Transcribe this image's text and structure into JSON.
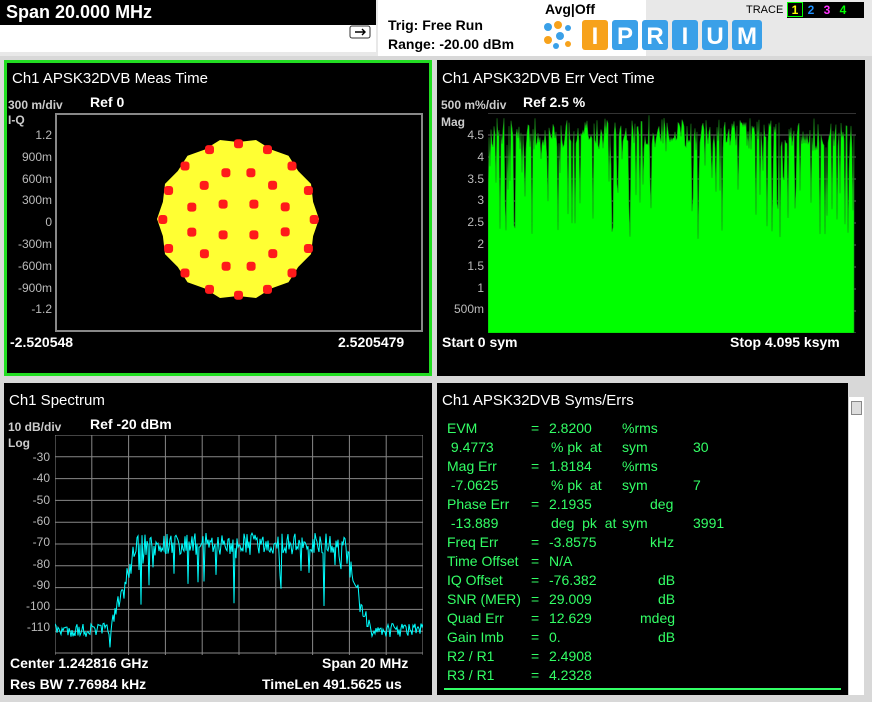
{
  "header": {
    "span_title": "Span 20.000 MHz",
    "trigger": "Trig: Free Run",
    "range": "Range: -20.00 dBm",
    "avg": "Avg|Off",
    "logo_text": "IPRIUM",
    "trace_label": "TRACE",
    "traces": [
      "1",
      "2",
      "3",
      "4"
    ]
  },
  "constellation": {
    "title": "Ch1 APSK32DVB Meas Time",
    "scale": "300 m/div",
    "ref": "Ref 0",
    "mode": "I-Q",
    "yticks": [
      "1.2",
      "900m",
      "600m",
      "300m",
      "0",
      "-300m",
      "-600m",
      "-900m",
      "-1.2"
    ],
    "x_start": "-2.520548",
    "x_stop": "2.5205479",
    "colors": {
      "cloud": "#ffff33",
      "points": "#ff1a1a"
    }
  },
  "errvect": {
    "title": "Ch1 APSK32DVB Err Vect Time",
    "scale": "500 m%/div",
    "ref": "Ref 2.5  %",
    "mode": "Mag",
    "yticks": [
      "4.5",
      "4",
      "3.5",
      "3",
      "2.5",
      "2",
      "1.5",
      "1",
      "500m"
    ],
    "start": "Start 0  sym",
    "stop": "Stop 4.095 ksym",
    "color": "#00ff00"
  },
  "spectrum": {
    "title": "Ch1 Spectrum",
    "scale": "10 dB/div",
    "ref": "Ref -20 dBm",
    "mode": "Log",
    "yticks": [
      "-30",
      "-40",
      "-50",
      "-60",
      "-70",
      "-80",
      "-90",
      "-100",
      "-110"
    ],
    "center": "Center 1.242816 GHz",
    "span": "Span 20 MHz",
    "rbw": "Res BW 7.76984 kHz",
    "timelen": "TimeLen 491.5625 us",
    "color": "#00ffff"
  },
  "symserr": {
    "title": "Ch1 APSK32DVB Syms/Errs",
    "rows": [
      {
        "label": "EVM",
        "eq": "=",
        "value": "2.8200",
        "unit": "%rms",
        "extra": ""
      },
      {
        "label": " 9.4773",
        "eq": "",
        "value": "% pk  at",
        "unit": "sym",
        "extra": "30"
      },
      {
        "label": "Mag Err",
        "eq": "=",
        "value": "1.8184",
        "unit": "%rms",
        "extra": ""
      },
      {
        "label": " -7.0625",
        "eq": "",
        "value": "% pk  at",
        "unit": "sym",
        "extra": "7"
      },
      {
        "label": "Phase Err",
        "eq": "=",
        "value": "2.1935",
        "unit": "deg",
        "extra": ""
      },
      {
        "label": " -13.889",
        "eq": "",
        "value": "deg  pk  at",
        "unit": "sym",
        "extra": "3991"
      },
      {
        "label": "Freq Err",
        "eq": "=",
        "value": "-3.8575",
        "unit": "kHz",
        "extra": ""
      },
      {
        "label": "Time Offset",
        "eq": "=",
        "value": "N/A",
        "unit": "",
        "extra": ""
      },
      {
        "label": "IQ Offset",
        "eq": "=",
        "value": "-76.382",
        "unit": "dB",
        "extra": ""
      },
      {
        "label": "SNR (MER)",
        "eq": "=",
        "value": "29.009",
        "unit": "dB",
        "extra": ""
      },
      {
        "label": "Quad Err",
        "eq": "=",
        "value": "12.629",
        "unit": "mdeg",
        "extra": ""
      },
      {
        "label": "Gain Imb",
        "eq": "=",
        "value": "0.",
        "unit": "dB",
        "extra": ""
      },
      {
        "label": "R2 / R1",
        "eq": "=",
        "value": "2.4908",
        "unit": "",
        "extra": ""
      },
      {
        "label": "R3 / R1",
        "eq": "=",
        "value": "4.2328",
        "unit": "",
        "extra": ""
      }
    ],
    "text_color": "#33ff66"
  }
}
